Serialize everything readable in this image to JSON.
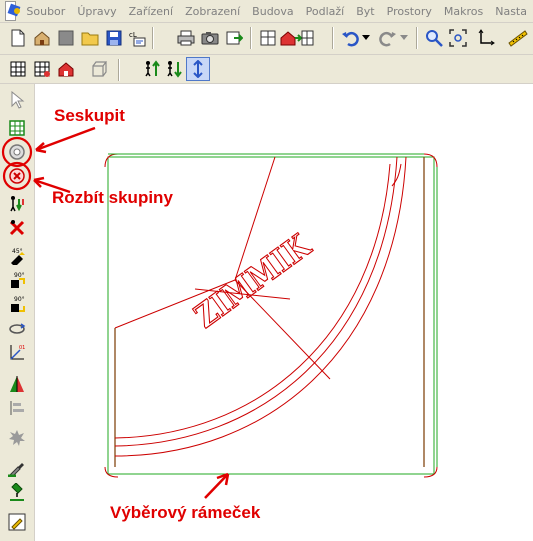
{
  "menu": {
    "items": [
      "Soubor",
      "Úpravy",
      "Zařízení",
      "Zobrazení",
      "Budova",
      "Podlaží",
      "Byt",
      "Prostory",
      "Makros",
      "Nasta"
    ]
  },
  "toolbar": {
    "icons": [
      "new-document-icon",
      "house-open-icon",
      "save-gray-icon",
      "open-folder-icon",
      "save-icon",
      "copy-layer-icon",
      "print-icon",
      "camera-icon",
      "export-icon",
      "building-icon",
      "house-export-icon",
      "undo-icon",
      "redo-icon",
      "zoom-icon",
      "zoom-fit-icon",
      "axes-icon",
      "ruler-icon"
    ]
  },
  "canvas": {
    "drawing_text": "ZIMMIK",
    "colors": {
      "frame": "#22aa22",
      "drawing": "#cc0000",
      "annotation": "#e00000"
    }
  },
  "annotations": {
    "group": "Seskupit",
    "ungroup": "Rozbít skupiny",
    "selection_frame": "Výběrový rámeček"
  }
}
